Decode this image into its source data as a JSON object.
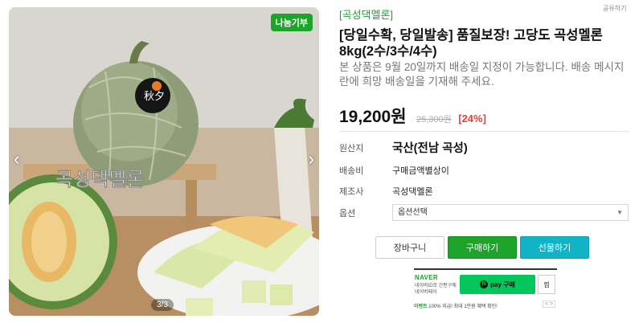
{
  "gallery": {
    "badge": "나눔기부",
    "watermark": "곡성댁멜론",
    "label_text": "秋夕",
    "counter": "3/3",
    "prev_arrow": "‹",
    "next_arrow": "›"
  },
  "store": {
    "name": "[곡성댁멜론]",
    "share": "공유하기"
  },
  "product": {
    "title": "[당일수확, 당일발송] 품질보장! 고당도 곡성멜론 8kg(2수/3수/4수)",
    "description": "본 상품은 9월 20일까지 배송일 지정이 가능합니다. 배송 메시지란에 희망 배송일을 기재해 주세요.",
    "price": "19,200원",
    "original_price": "25,300원",
    "discount": "[24%]"
  },
  "specs": {
    "origin_label": "원산지",
    "origin_value": "국산(전남 곡성)",
    "shipping_label": "배송비",
    "shipping_value": "구매금액별상이",
    "maker_label": "제조사",
    "maker_value": "곡성댁멜론",
    "option_label": "옵션",
    "option_placeholder": "옵션선택"
  },
  "buttons": {
    "cart": "장바구니",
    "buy": "구매하기",
    "gift": "선물하기"
  },
  "naver": {
    "logo": "NAVER",
    "sub": "네이버ID로 간편구매 네이버페이",
    "pay_label": "pay 구매",
    "pay_icon": "N",
    "zzim": "찜",
    "event_prefix": "이벤트",
    "event_text": "100% 지급! 최대 1만원 혜택 확인!",
    "event_nav": "< >"
  },
  "colors": {
    "accent_green": "#1ea32b",
    "gift_teal": "#11b3c7",
    "discount_red": "#f03c3c",
    "npay_green": "#03c75a"
  }
}
